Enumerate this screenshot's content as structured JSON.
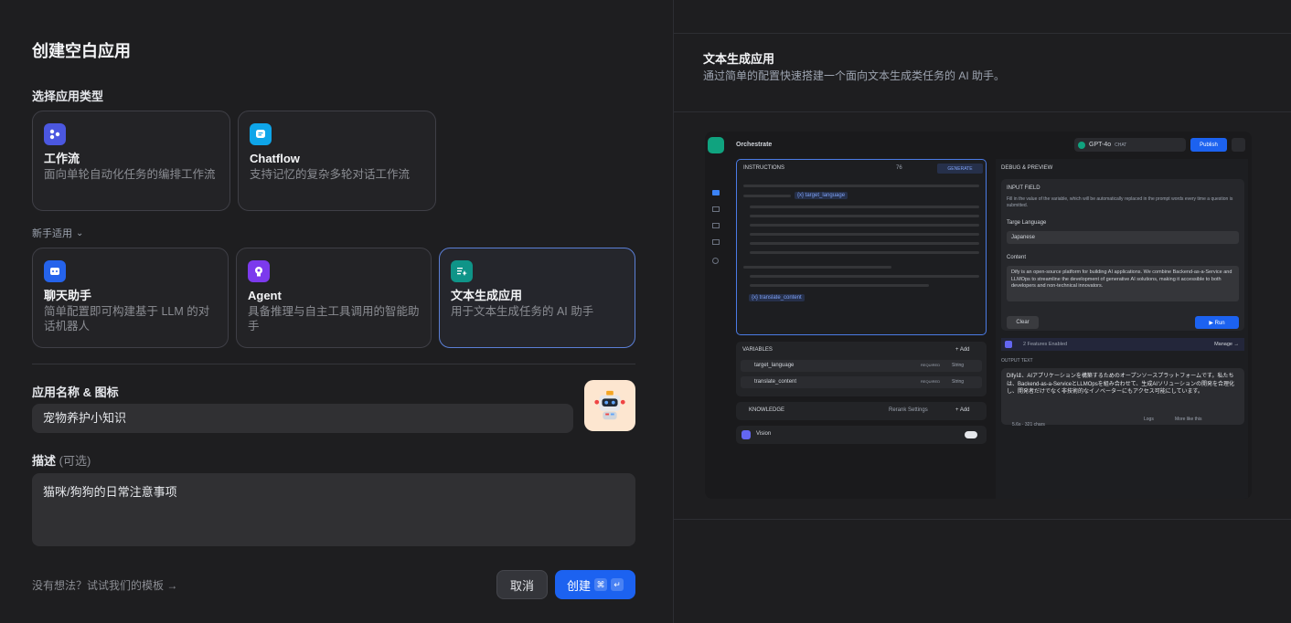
{
  "left": {
    "title": "创建空白应用",
    "type_section": "选择应用类型",
    "cards_top": [
      {
        "name": "工作流",
        "desc": "面向单轮自动化任务的编排工作流",
        "icon": "workflow-icon",
        "color": "#4b57e0"
      },
      {
        "name": "Chatflow",
        "desc": "支持记忆的复杂多轮对话工作流",
        "icon": "chatflow-icon",
        "color": "#0ea5e9"
      }
    ],
    "novice_label": "新手适用",
    "cards_bottom": [
      {
        "name": "聊天助手",
        "desc": "简单配置即可构建基于 LLM 的对话机器人",
        "icon": "chat-assistant-icon",
        "color": "#2563eb"
      },
      {
        "name": "Agent",
        "desc": "具备推理与自主工具调用的智能助手",
        "icon": "agent-icon",
        "color": "#7c3aed"
      },
      {
        "name": "文本生成应用",
        "desc": "用于文本生成任务的 AI 助手",
        "icon": "text-generation-icon",
        "color": "#0f9488"
      }
    ],
    "name_section": "应用名称 & 图标",
    "app_name": "宠物养护小知识",
    "desc_section": "描述",
    "desc_optional": "(可选)",
    "description": "猫咪/狗狗的日常注意事项",
    "template_link": "没有想法？试试我们的模板 →",
    "cancel": "取消",
    "create": "创建",
    "create_kbd1": "⌘",
    "create_kbd2": "↵"
  },
  "right": {
    "title": "文本生成应用",
    "desc": "通过简单的配置快速搭建一个面向文本生成类任务的 AI 助手。",
    "preview": {
      "orchestrate": "Orchestrate",
      "model": "GPT-4o",
      "model_tag": "CHAT",
      "publish": "Publish",
      "instructions": "INSTRUCTIONS",
      "char_count": "76",
      "generate": "GENERATE",
      "var1_chip": "{x} target_language",
      "var2_chip": "{x} translate_content",
      "variables": "VARIABLES",
      "add": "+ Add",
      "var_rows": [
        {
          "name": "target_language",
          "req": "REQUIRED",
          "type": "String"
        },
        {
          "name": "translate_content",
          "req": "REQUIRED",
          "type": "String"
        }
      ],
      "knowledge": "KNOWLEDGE",
      "rerank": "Rerank Settings",
      "vision": "Vision",
      "debug": "DEBUG & PREVIEW",
      "input_field": "INPUT FIELD",
      "input_hint": "Fill in the value of the variable, which will be automatically replaced in the prompt words every time a question is submitted.",
      "target_label": "Targe Language",
      "target_value": "Japanese",
      "content_label": "Content",
      "content_value": "Dify is an open-source platform for building AI applications. We combine Backend-as-a-Service and LLMOps to streamline the development of generative AI solutions, making it accessible to both developers and non-technical innovators.",
      "clear": "Clear",
      "run": "▶ Run",
      "features": "2 Features Enabled",
      "manage": "Manage →",
      "output_label": "OUTPUT TEXT",
      "output": "Difyは、AIアプリケーションを構築するためのオープンソースプラットフォームです。私たちは、Backend-as-a-ServiceとLLMOpsを組み合わせて、生成AIソリューションの開発を合理化し、開発者だけでなく非技術的なイノベーターにもアクセス可能にしています。",
      "stats": "5.6s · 321 chars",
      "logs": "Logs",
      "more_like": "More like this"
    }
  }
}
